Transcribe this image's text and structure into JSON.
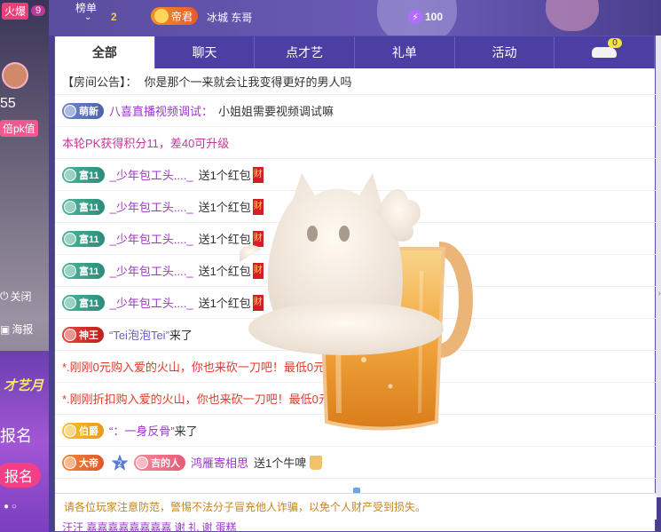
{
  "left_strip": {
    "top_label": "火爆",
    "top_count": "9",
    "viewer_count": "55",
    "pk_label": "倍pk值",
    "close_label": "关闭",
    "poster_label": "海报",
    "promo_title": "才艺月",
    "promo_text": "报名",
    "promo_button": "报名"
  },
  "topbar": {
    "rank_label": "榜单",
    "rank_num": "2",
    "badge_label": "帝君",
    "user_name": "冰城 东哥",
    "score": "100"
  },
  "tabs": [
    {
      "label": "全部",
      "active": true
    },
    {
      "label": "聊天",
      "active": false
    },
    {
      "label": "点才艺",
      "active": false
    },
    {
      "label": "礼单",
      "active": false
    },
    {
      "label": "活动",
      "active": false
    }
  ],
  "car_badge": "0",
  "messages": {
    "announcement_label": "【房间公告】：",
    "announcement_text": "你是那个一来就会让我变得更好的男人吗",
    "m1_badge": "萌新",
    "m1_nick": "八喜直播视频调试：",
    "m1_text": "小姐姐需要视频调试嘛",
    "pk_text": "本轮PK获得积分11，差40可升级",
    "gift_badge": "富11",
    "gift_nick": "_少年包工头...._",
    "gift_text": "送1个红包",
    "hb_char": "财",
    "m_shen_badge": "神王",
    "m_shen_nick": "“Tei泡泡Tei”",
    "m_shen_text": "来了",
    "bargain1": "*.刚刚0元购入爱的火山，你也来砍一刀吧！最低0元购",
    "bargain2": "*.刚刚折扣购入爱的火山，你也来砍一刀吧！最低0元购",
    "m_bo_badge": "伯爵",
    "m_bo_nick": "“：一身反骨”",
    "m_bo_text": "来了",
    "m_di_badge": "大帝",
    "m_di_level": "2",
    "m_ji_badge": "吉的人",
    "m_di_nick": "鸿雁寄相思",
    "m_di_text": "送1个牛啤"
  },
  "warning": "请各位玩家注意防范，警惕不法分子冒充他人诈骗，以免个人财产受到损失。",
  "bottom_line": "汪汪    嘉嘉嘉嘉嘉嘉嘉嘉   谢 礼   谢      蛋糕"
}
